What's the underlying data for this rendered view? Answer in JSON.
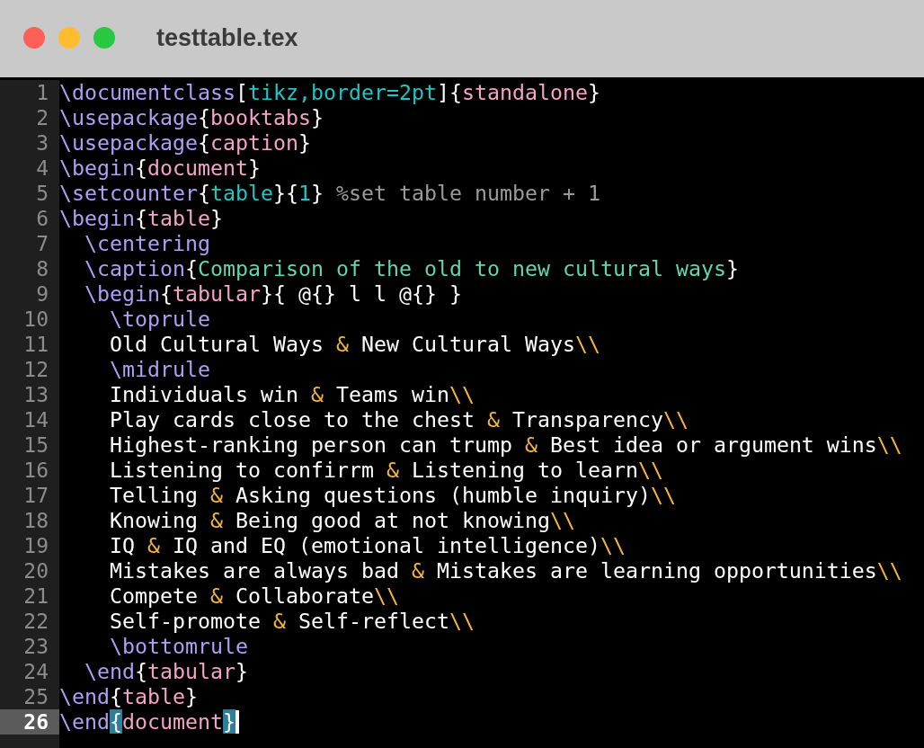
{
  "window": {
    "title": "testtable.tex"
  },
  "editor": {
    "lines": [
      {
        "number": "1",
        "selected": false,
        "tokens": [
          {
            "kind": "cmd",
            "text": "\\documentclass"
          },
          {
            "kind": "plain",
            "text": "["
          },
          {
            "kind": "opt",
            "text": "tikz,border=2pt"
          },
          {
            "kind": "plain",
            "text": "]{"
          },
          {
            "kind": "arg",
            "text": "standalone"
          },
          {
            "kind": "plain",
            "text": "}"
          }
        ]
      },
      {
        "number": "2",
        "selected": false,
        "tokens": [
          {
            "kind": "cmd",
            "text": "\\usepackage"
          },
          {
            "kind": "plain",
            "text": "{"
          },
          {
            "kind": "arg",
            "text": "booktabs"
          },
          {
            "kind": "plain",
            "text": "}"
          }
        ]
      },
      {
        "number": "3",
        "selected": false,
        "tokens": [
          {
            "kind": "cmd",
            "text": "\\usepackage"
          },
          {
            "kind": "plain",
            "text": "{"
          },
          {
            "kind": "arg",
            "text": "caption"
          },
          {
            "kind": "plain",
            "text": "}"
          }
        ]
      },
      {
        "number": "4",
        "selected": false,
        "tokens": [
          {
            "kind": "cmd",
            "text": "\\begin"
          },
          {
            "kind": "plain",
            "text": "{"
          },
          {
            "kind": "arg",
            "text": "document"
          },
          {
            "kind": "plain",
            "text": "}"
          }
        ]
      },
      {
        "number": "5",
        "selected": false,
        "tokens": [
          {
            "kind": "cmd",
            "text": "\\setcounter"
          },
          {
            "kind": "plain",
            "text": "{"
          },
          {
            "kind": "opt",
            "text": "table"
          },
          {
            "kind": "plain",
            "text": "}{"
          },
          {
            "kind": "opt",
            "text": "1"
          },
          {
            "kind": "plain",
            "text": "} "
          },
          {
            "kind": "comment",
            "text": "%set table number + 1"
          }
        ]
      },
      {
        "number": "6",
        "selected": false,
        "tokens": [
          {
            "kind": "cmd",
            "text": "\\begin"
          },
          {
            "kind": "plain",
            "text": "{"
          },
          {
            "kind": "arg",
            "text": "table"
          },
          {
            "kind": "plain",
            "text": "}"
          }
        ]
      },
      {
        "number": "7",
        "selected": false,
        "tokens": [
          {
            "kind": "cmd",
            "text": "  \\centering"
          }
        ]
      },
      {
        "number": "8",
        "selected": false,
        "tokens": [
          {
            "kind": "cmd",
            "text": "  \\caption"
          },
          {
            "kind": "plain",
            "text": "{"
          },
          {
            "kind": "str",
            "text": "Comparison of the old to new cultural ways"
          },
          {
            "kind": "plain",
            "text": "}"
          }
        ]
      },
      {
        "number": "9",
        "selected": false,
        "tokens": [
          {
            "kind": "cmd",
            "text": "  \\begin"
          },
          {
            "kind": "plain",
            "text": "{"
          },
          {
            "kind": "arg",
            "text": "tabular"
          },
          {
            "kind": "plain",
            "text": "}{ @{} l l @{} }"
          }
        ]
      },
      {
        "number": "10",
        "selected": false,
        "tokens": [
          {
            "kind": "cmd",
            "text": "    \\toprule"
          }
        ]
      },
      {
        "number": "11",
        "selected": false,
        "tokens": [
          {
            "kind": "plain",
            "text": "    Old Cultural Ways "
          },
          {
            "kind": "op",
            "text": "&"
          },
          {
            "kind": "plain",
            "text": " New Cultural Ways"
          },
          {
            "kind": "op",
            "text": "\\\\"
          }
        ]
      },
      {
        "number": "12",
        "selected": false,
        "tokens": [
          {
            "kind": "cmd",
            "text": "    \\midrule"
          }
        ]
      },
      {
        "number": "13",
        "selected": false,
        "tokens": [
          {
            "kind": "plain",
            "text": "    Individuals win "
          },
          {
            "kind": "op",
            "text": "&"
          },
          {
            "kind": "plain",
            "text": " Teams win"
          },
          {
            "kind": "op",
            "text": "\\\\"
          }
        ]
      },
      {
        "number": "14",
        "selected": false,
        "tokens": [
          {
            "kind": "plain",
            "text": "    Play cards close to the chest "
          },
          {
            "kind": "op",
            "text": "&"
          },
          {
            "kind": "plain",
            "text": " Transparency"
          },
          {
            "kind": "op",
            "text": "\\\\"
          }
        ]
      },
      {
        "number": "15",
        "selected": false,
        "tokens": [
          {
            "kind": "plain",
            "text": "    Highest-ranking person can trump "
          },
          {
            "kind": "op",
            "text": "&"
          },
          {
            "kind": "plain",
            "text": " Best idea or argument wins"
          },
          {
            "kind": "op",
            "text": "\\\\"
          }
        ]
      },
      {
        "number": "16",
        "selected": false,
        "tokens": [
          {
            "kind": "plain",
            "text": "    Listening to confirrm "
          },
          {
            "kind": "op",
            "text": "&"
          },
          {
            "kind": "plain",
            "text": " Listening to learn"
          },
          {
            "kind": "op",
            "text": "\\\\"
          }
        ]
      },
      {
        "number": "17",
        "selected": false,
        "tokens": [
          {
            "kind": "plain",
            "text": "    Telling "
          },
          {
            "kind": "op",
            "text": "&"
          },
          {
            "kind": "plain",
            "text": " Asking questions (humble inquiry)"
          },
          {
            "kind": "op",
            "text": "\\\\"
          }
        ]
      },
      {
        "number": "18",
        "selected": false,
        "tokens": [
          {
            "kind": "plain",
            "text": "    Knowing "
          },
          {
            "kind": "op",
            "text": "&"
          },
          {
            "kind": "plain",
            "text": " Being good at not knowing"
          },
          {
            "kind": "op",
            "text": "\\\\"
          }
        ]
      },
      {
        "number": "19",
        "selected": false,
        "tokens": [
          {
            "kind": "plain",
            "text": "    IQ "
          },
          {
            "kind": "op",
            "text": "&"
          },
          {
            "kind": "plain",
            "text": " IQ and EQ (emotional intelligence)"
          },
          {
            "kind": "op",
            "text": "\\\\"
          }
        ]
      },
      {
        "number": "20",
        "selected": false,
        "tokens": [
          {
            "kind": "plain",
            "text": "    Mistakes are always bad "
          },
          {
            "kind": "op",
            "text": "&"
          },
          {
            "kind": "plain",
            "text": " Mistakes are learning opportunities"
          },
          {
            "kind": "op",
            "text": "\\\\"
          }
        ]
      },
      {
        "number": "21",
        "selected": false,
        "tokens": [
          {
            "kind": "plain",
            "text": "    Compete "
          },
          {
            "kind": "op",
            "text": "&"
          },
          {
            "kind": "plain",
            "text": " Collaborate"
          },
          {
            "kind": "op",
            "text": "\\\\"
          }
        ]
      },
      {
        "number": "22",
        "selected": false,
        "tokens": [
          {
            "kind": "plain",
            "text": "    Self-promote "
          },
          {
            "kind": "op",
            "text": "&"
          },
          {
            "kind": "plain",
            "text": " Self-reflect"
          },
          {
            "kind": "op",
            "text": "\\\\"
          }
        ]
      },
      {
        "number": "23",
        "selected": false,
        "tokens": [
          {
            "kind": "cmd",
            "text": "    \\bottomrule"
          }
        ]
      },
      {
        "number": "24",
        "selected": false,
        "tokens": [
          {
            "kind": "cmd",
            "text": "  \\end"
          },
          {
            "kind": "plain",
            "text": "{"
          },
          {
            "kind": "arg",
            "text": "tabular"
          },
          {
            "kind": "plain",
            "text": "}"
          }
        ]
      },
      {
        "number": "25",
        "selected": false,
        "tokens": [
          {
            "kind": "cmd",
            "text": "\\end"
          },
          {
            "kind": "plain",
            "text": "{"
          },
          {
            "kind": "arg",
            "text": "table"
          },
          {
            "kind": "plain",
            "text": "}"
          }
        ]
      },
      {
        "number": "26",
        "selected": true,
        "tokens": [
          {
            "kind": "cmd",
            "text": "\\end"
          },
          {
            "kind": "match",
            "text": "{"
          },
          {
            "kind": "arg",
            "text": "document"
          },
          {
            "kind": "match",
            "text": "}"
          }
        ]
      }
    ]
  }
}
